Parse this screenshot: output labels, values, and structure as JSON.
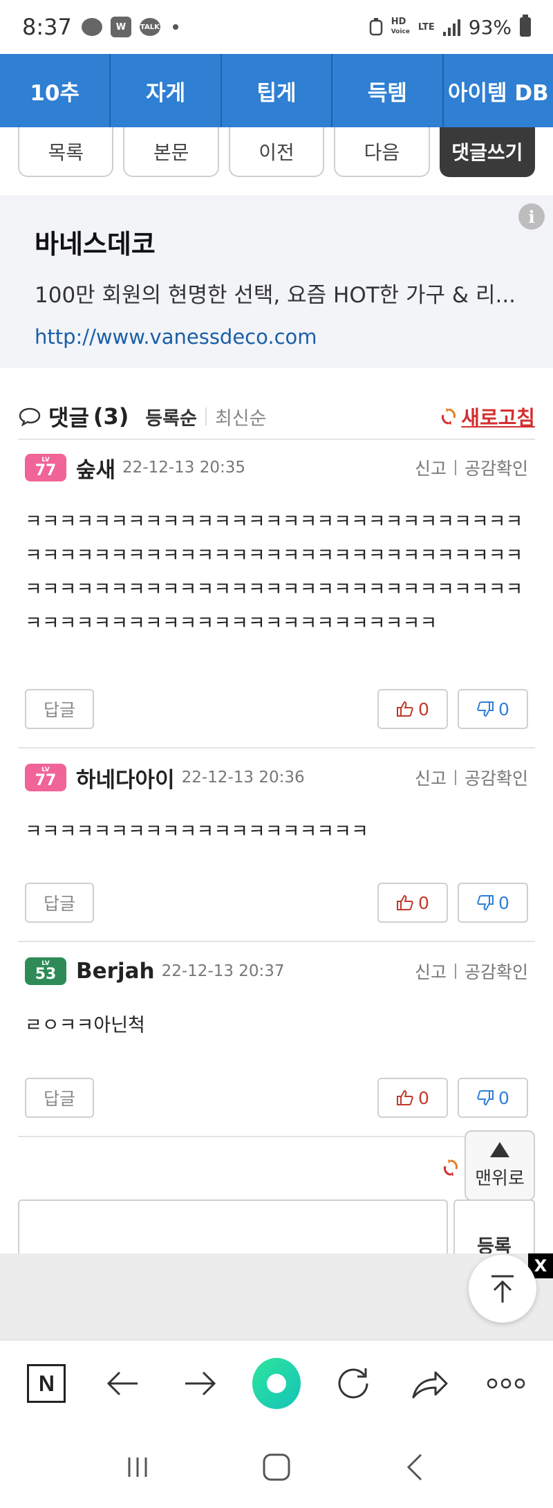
{
  "status_bar": {
    "time": "8:37",
    "app_icons": [
      "chat-bubble-icon",
      "w-app-icon",
      "talk-icon"
    ],
    "network_badge_top": "HD",
    "network_badge_bottom": "Voice",
    "lte_label": "LTE",
    "battery": "93%"
  },
  "top_nav": {
    "items": [
      "10추",
      "자게",
      "팁게",
      "득템",
      "아이템 DB"
    ]
  },
  "board_buttons": {
    "list": "목록",
    "body": "본문",
    "prev": "이전",
    "next": "다음",
    "write_comment": "댓글쓰기"
  },
  "ad": {
    "title": "바네스데코",
    "description": "100만 회원의 현명한 선택, 요즘 HOT한 가구 & 리...",
    "url": "http://www.vanessdeco.com",
    "info_icon_glyph": "i"
  },
  "comments_header": {
    "title": "댓글",
    "count": "(3)",
    "sort_registered": "등록순",
    "sort_latest": "최신순",
    "refresh": "새로고침"
  },
  "comments": [
    {
      "level_tag": "LV",
      "level": "77",
      "level_color": "#f06497",
      "nickname": "숲새",
      "date": "22-12-13 20:35",
      "report": "신고",
      "empathy_check": "공감확인",
      "body": "ㅋㅋㅋㅋㅋㅋㅋㅋㅋㅋㅋㅋㅋㅋㅋㅋㅋㅋㅋㅋㅋㅋㅋㅋㅋㅋㅋㅋㅋㅋㅋㅋㅋㅋㅋㅋㅋㅋㅋㅋㅋㅋㅋㅋㅋㅋㅋㅋㅋㅋㅋㅋㅋㅋㅋㅋㅋㅋㅋㅋㅋㅋㅋㅋㅋㅋㅋㅋㅋㅋㅋㅋㅋㅋㅋㅋㅋㅋㅋㅋㅋㅋㅋㅋㅋㅋㅋㅋㅋㅋㅋㅋㅋㅋㅋㅋㅋㅋㅋㅋㅋㅋㅋㅋㅋㅋㅋㅋㅋㅋㅋ",
      "reply": "답글",
      "likes": "0",
      "dislikes": "0"
    },
    {
      "level_tag": "LV",
      "level": "77",
      "level_color": "#f06497",
      "nickname": "하네다아이",
      "date": "22-12-13 20:36",
      "report": "신고",
      "empathy_check": "공감확인",
      "body": "ㅋㅋㅋㅋㅋㅋㅋㅋㅋㅋㅋㅋㅋㅋㅋㅋㅋㅋㅋㅋ",
      "reply": "답글",
      "likes": "0",
      "dislikes": "0"
    },
    {
      "level_tag": "LV",
      "level": "53",
      "level_color": "#2e8b57",
      "nickname": "Berjah",
      "date": "22-12-13 20:37",
      "report": "신고",
      "empathy_check": "공감확인",
      "body": "ㄹㅇㅋㅋ아닌척",
      "reply": "답글",
      "likes": "0",
      "dislikes": "0"
    }
  ],
  "compose": {
    "register": "등록",
    "to_top": "맨위로"
  },
  "ad_banner": {
    "close": "X"
  },
  "browser_toolbar": {
    "icons": [
      "naver-n-icon",
      "back-arrow-icon",
      "forward-arrow-icon",
      "green-dot-icon",
      "reload-icon",
      "share-icon",
      "more-icon"
    ],
    "naver_letter": "N"
  },
  "android_nav": {
    "icons": [
      "recent-apps-icon",
      "home-icon",
      "back-icon"
    ]
  }
}
